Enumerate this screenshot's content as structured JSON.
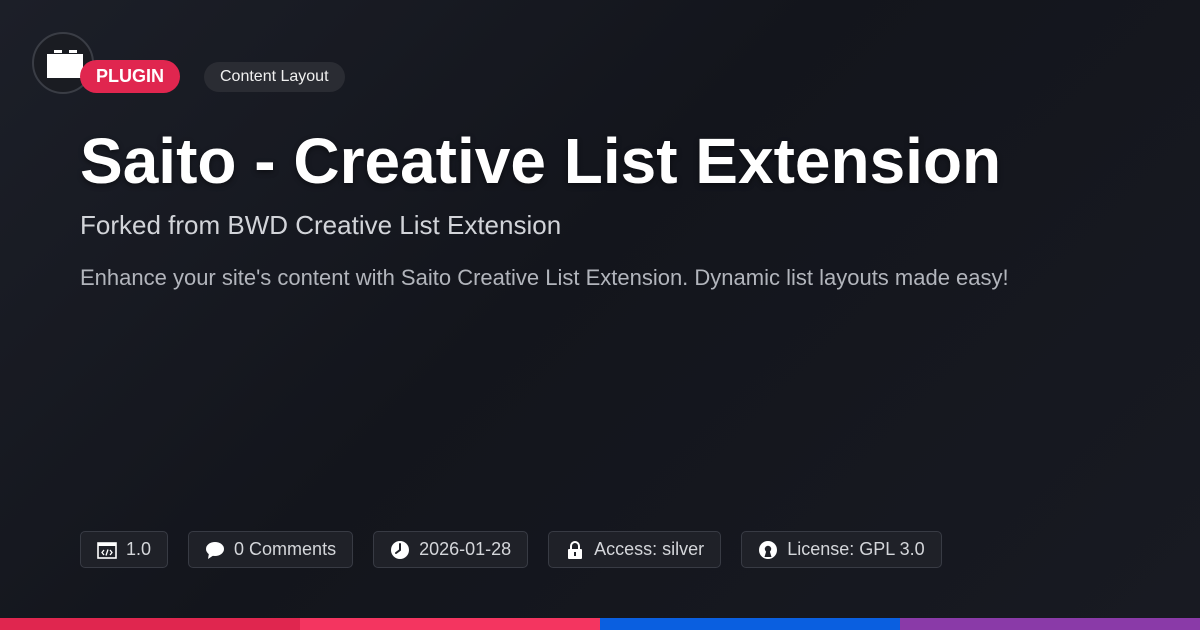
{
  "logo": {
    "icon": "plugin-block-icon"
  },
  "tags": {
    "type_label": "PLUGIN",
    "category_label": "Content Layout"
  },
  "title": "Saito - Creative List Extension",
  "subtitle": "Forked from BWD Creative List Extension",
  "description": "Enhance your site's content with Saito Creative List Extension. Dynamic list layouts made easy!",
  "meta": {
    "version": {
      "icon": "code-window-icon",
      "text": "1.0"
    },
    "comments": {
      "icon": "speech-bubble-icon",
      "text": "0 Comments"
    },
    "date": {
      "icon": "clock-icon",
      "text": "2026-01-28"
    },
    "access": {
      "icon": "lock-icon",
      "text": "Access: silver"
    },
    "license": {
      "icon": "open-source-icon",
      "text": "License: GPL 3.0"
    }
  },
  "colors": {
    "accent": "#e0264f",
    "background": "#15171e",
    "bar": [
      "#e0264f",
      "#f43560",
      "#0a5fe0",
      "#8a3aa8"
    ]
  }
}
